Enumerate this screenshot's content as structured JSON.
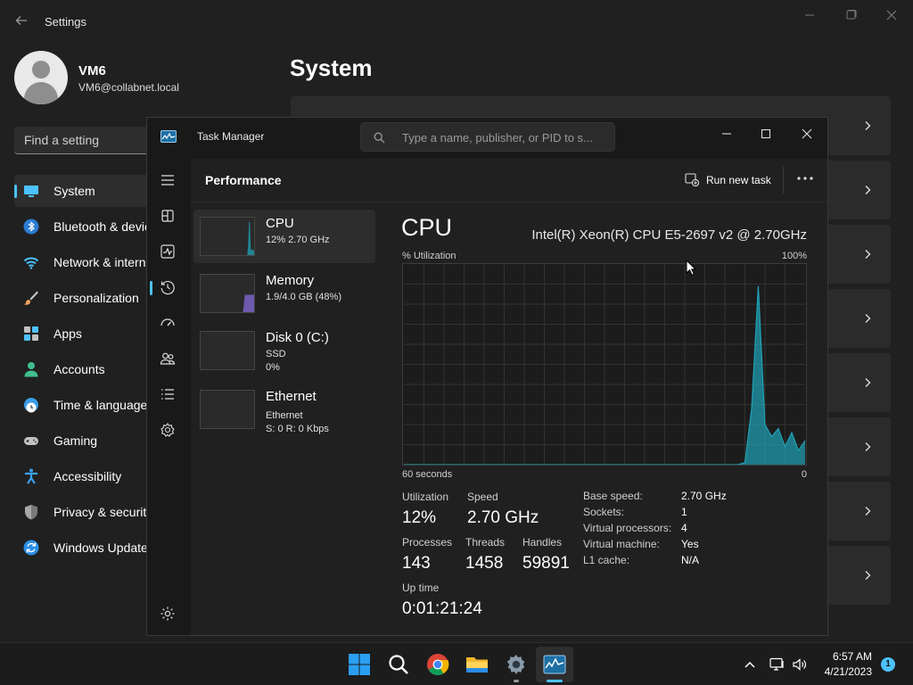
{
  "settings": {
    "title": "Settings",
    "user": {
      "name": "VM6",
      "email": "VM6@collabnet.local"
    },
    "search_placeholder": "Find a setting",
    "page_title": "System",
    "nav": [
      {
        "label": "System",
        "icon": "monitor-icon",
        "selected": true
      },
      {
        "label": "Bluetooth & devices",
        "icon": "bluetooth-icon"
      },
      {
        "label": "Network & internet",
        "icon": "wifi-icon"
      },
      {
        "label": "Personalization",
        "icon": "brush-icon"
      },
      {
        "label": "Apps",
        "icon": "apps-icon"
      },
      {
        "label": "Accounts",
        "icon": "person-icon"
      },
      {
        "label": "Time & language",
        "icon": "globe-clock-icon"
      },
      {
        "label": "Gaming",
        "icon": "gamepad-icon"
      },
      {
        "label": "Accessibility",
        "icon": "accessibility-icon"
      },
      {
        "label": "Privacy & security",
        "icon": "shield-icon"
      },
      {
        "label": "Windows Update",
        "icon": "update-icon"
      }
    ]
  },
  "task_manager": {
    "title": "Task Manager",
    "search_placeholder": "Type a name, publisher, or PID to s...",
    "section_title": "Performance",
    "run_new_task": "Run new task",
    "resources": [
      {
        "name": "CPU",
        "sub1": "12% 2.70 GHz",
        "sub2": "",
        "selected": true,
        "color": "#1fa3b7"
      },
      {
        "name": "Memory",
        "sub1": "1.9/4.0 GB (48%)",
        "sub2": "",
        "color": "#8a6fe8"
      },
      {
        "name": "Disk 0 (C:)",
        "sub1": "SSD",
        "sub2": "0%",
        "color": "#4caf50"
      },
      {
        "name": "Ethernet",
        "sub1": "Ethernet",
        "sub2": "S: 0 R: 0 Kbps",
        "color": "#c47a2b"
      }
    ],
    "cpu": {
      "heading": "CPU",
      "model": "Intel(R) Xeon(R) CPU E5-2697 v2 @ 2.70GHz",
      "graph_label": "% Utilization",
      "graph_max": "100%",
      "graph_time": "60 seconds",
      "graph_min": "0",
      "stats": {
        "utilization_label": "Utilization",
        "utilization": "12%",
        "speed_label": "Speed",
        "speed": "2.70 GHz",
        "processes_label": "Processes",
        "processes": "143",
        "threads_label": "Threads",
        "threads": "1458",
        "handles_label": "Handles",
        "handles": "59891",
        "uptime_label": "Up time",
        "uptime": "0:01:21:24"
      },
      "details": [
        {
          "k": "Base speed:",
          "v": "2.70 GHz"
        },
        {
          "k": "Sockets:",
          "v": "1"
        },
        {
          "k": "Virtual processors:",
          "v": "4"
        },
        {
          "k": "Virtual machine:",
          "v": "Yes"
        },
        {
          "k": "L1 cache:",
          "v": "N/A"
        }
      ],
      "chart_data": {
        "type": "area",
        "x": [
          0,
          1,
          2,
          3,
          4,
          5,
          6,
          7,
          8,
          9,
          10,
          11,
          12,
          13,
          14,
          15,
          16,
          17,
          18,
          19,
          20,
          21,
          22,
          23,
          24,
          25,
          26,
          27,
          28,
          29,
          30,
          31,
          32,
          33,
          34,
          35,
          36,
          37,
          38,
          39,
          40,
          41,
          42,
          43,
          44,
          45,
          46,
          47,
          48,
          49,
          50,
          51,
          52,
          53,
          54,
          55,
          56,
          57,
          58,
          59,
          60
        ],
        "values": [
          0,
          0,
          0,
          0,
          0,
          0,
          0,
          0,
          0,
          0,
          0,
          0,
          0,
          0,
          0,
          0,
          0,
          0,
          0,
          0,
          0,
          0,
          0,
          0,
          0,
          0,
          0,
          0,
          0,
          0,
          0,
          0,
          0,
          0,
          0,
          0,
          0,
          0,
          0,
          0,
          0,
          0,
          0,
          0,
          0,
          0,
          0,
          0,
          0,
          0,
          0,
          1,
          28,
          89,
          20,
          14,
          18,
          9,
          16,
          7,
          12
        ],
        "xlabel": "60 seconds",
        "ylabel": "% Utilization",
        "ylim": [
          0,
          100
        ],
        "color": "#1fa3b7"
      }
    }
  },
  "taskbar": {
    "time": "6:57 AM",
    "date": "4/21/2023",
    "notifications": "1"
  }
}
